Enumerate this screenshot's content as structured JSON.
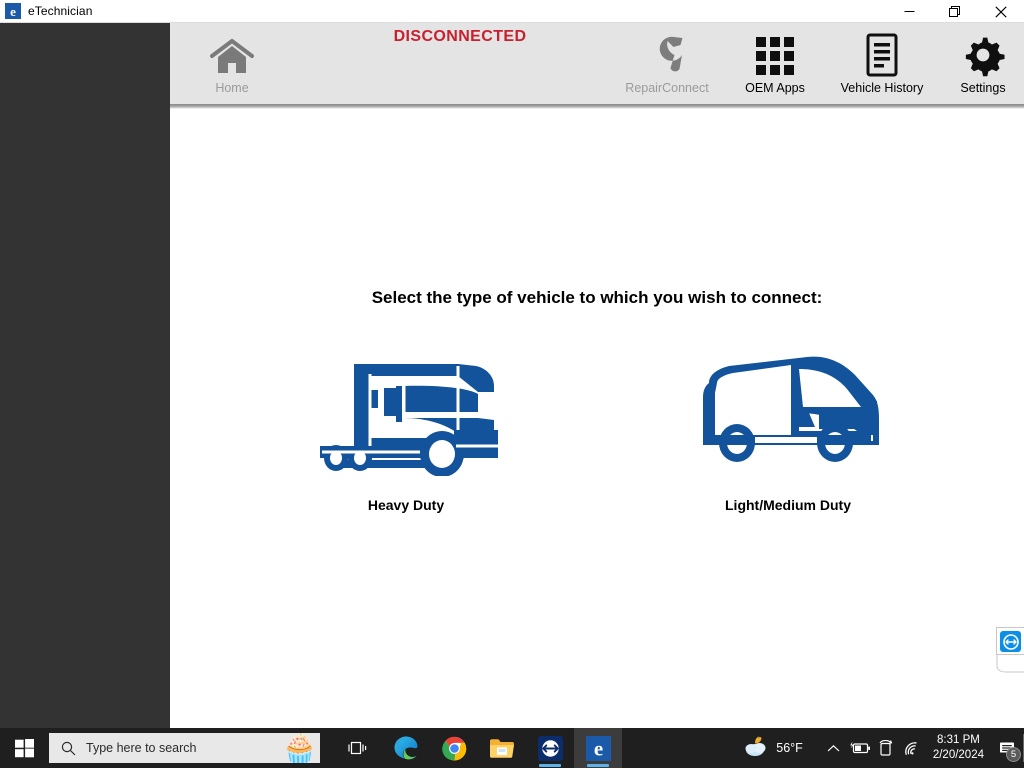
{
  "window": {
    "title": "eTechnician",
    "logo_letter": "e",
    "controls": {
      "minimize": "minimize-button",
      "restore": "restore-button",
      "close": "close-button"
    }
  },
  "toolbar": {
    "status": "DISCONNECTED",
    "status_color": "#c8202e",
    "items": [
      {
        "id": "home",
        "label": "Home",
        "icon": "home-icon",
        "disabled": true
      },
      {
        "id": "repairconnect",
        "label": "RepairConnect",
        "icon": "wrench-icon",
        "disabled": true
      },
      {
        "id": "oemapps",
        "label": "OEM Apps",
        "icon": "grid-apps-icon",
        "disabled": false
      },
      {
        "id": "vehiclehistory",
        "label": "Vehicle History",
        "icon": "document-icon",
        "disabled": false
      },
      {
        "id": "settings",
        "label": "Settings",
        "icon": "gear-icon",
        "disabled": false
      }
    ]
  },
  "main": {
    "prompt": "Select the type of vehicle to which you wish to connect:",
    "accent_color": "#13539b",
    "choices": [
      {
        "id": "heavy",
        "label": "Heavy Duty",
        "icon": "semi-truck-icon"
      },
      {
        "id": "light",
        "label": "Light/Medium Duty",
        "icon": "cargo-van-icon"
      }
    ]
  },
  "overlay": {
    "teamviewer_widget": "teamviewer-floating-icon"
  },
  "taskbar": {
    "start": "windows-start-icon",
    "search": {
      "placeholder": "Type here to search",
      "icon": "search-icon",
      "decor": "🧁"
    },
    "pinned": [
      {
        "id": "taskview",
        "icon": "task-view-icon",
        "running": false,
        "active": false
      },
      {
        "id": "edge",
        "icon": "microsoft-edge-icon",
        "running": false,
        "active": false
      },
      {
        "id": "chrome",
        "icon": "google-chrome-icon",
        "running": false,
        "active": false
      },
      {
        "id": "explorer",
        "icon": "file-explorer-icon",
        "running": false,
        "active": false
      },
      {
        "id": "teamviewer",
        "icon": "teamviewer-icon",
        "running": true,
        "active": false
      },
      {
        "id": "etechnician",
        "icon": "etechnician-icon",
        "running": true,
        "active": true
      }
    ],
    "tray": {
      "weather_temp": "56°F",
      "weather_icon": "partly-cloudy-night-icon",
      "show_hidden": "chevron-up-icon",
      "battery": "battery-charging-icon",
      "rotation": "tablet-rotation-icon",
      "network": "wifi-icon",
      "time": "8:31 PM",
      "date": "2/20/2024",
      "notifications": "notifications-icon",
      "notification_count": "5"
    }
  }
}
